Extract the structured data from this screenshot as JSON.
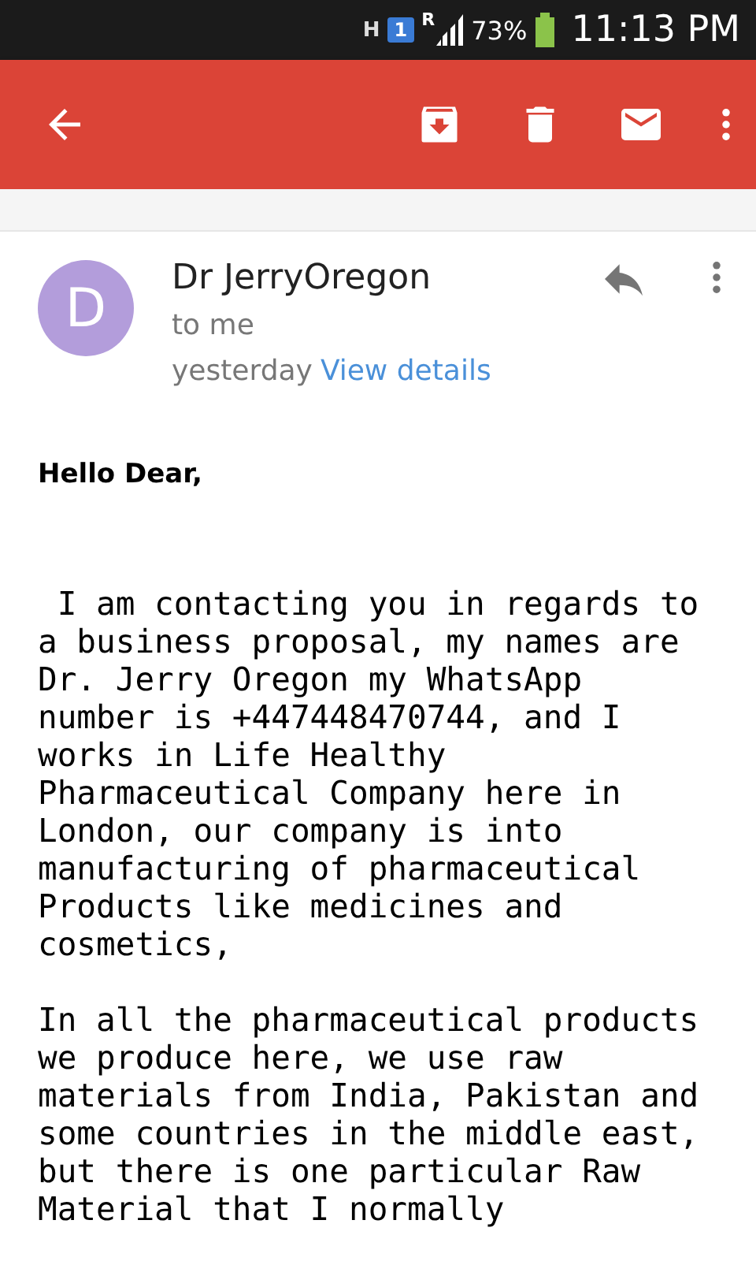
{
  "status_bar": {
    "network": "H",
    "sim": "1",
    "roaming": "R",
    "battery": "73%",
    "time": "11:13 PM"
  },
  "message": {
    "avatar_letter": "D",
    "sender": "Dr JerryOregon",
    "recipient": "to me",
    "date": "yesterday",
    "details_link": "View details"
  },
  "body": {
    "greeting": "Hello Dear,",
    "paragraphs": [
      " I am contacting you in regards to\na business proposal, my names are\nDr. Jerry Oregon my WhatsApp\nnumber is +447448470744, and I\nworks in Life Healthy\nPharmaceutical Company here in\nLondon, our company is into\nmanufacturing of pharmaceutical\nProducts like medicines and\ncosmetics,",
      "In all the pharmaceutical products\nwe produce here, we use raw\nmaterials from India, Pakistan and\nsome countries in the middle east,\nbut there is one particular Raw\nMaterial that I normally"
    ]
  }
}
